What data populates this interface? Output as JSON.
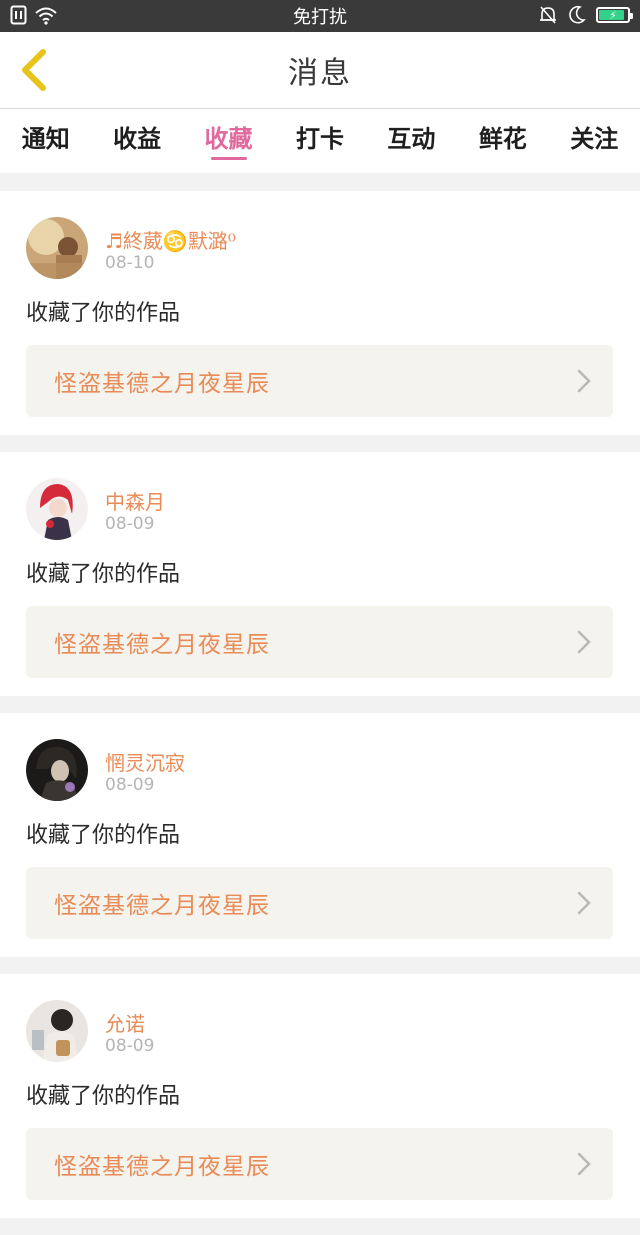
{
  "status_bar": {
    "mode_label": "免打扰",
    "battery_level": 0.9,
    "colors": {
      "background": "#3a3a3a",
      "battery": "#33d18a"
    },
    "icons": [
      "sim-icon",
      "wifi-icon",
      "mute-bell-icon",
      "moon-icon",
      "battery-icon"
    ]
  },
  "header": {
    "title": "消息",
    "back_icon": "chevron-left-icon",
    "colors": {
      "back": "#e8c31a"
    }
  },
  "tabs": [
    {
      "label": "通知",
      "active": false
    },
    {
      "label": "收益",
      "active": false
    },
    {
      "label": "收藏",
      "active": true
    },
    {
      "label": "打卡",
      "active": false
    },
    {
      "label": "互动",
      "active": false
    },
    {
      "label": "鲜花",
      "active": false
    },
    {
      "label": "关注",
      "active": false
    }
  ],
  "colors": {
    "accent": "#e06a9d",
    "username": "#e98b57",
    "work_bg": "#f4f3ee"
  },
  "messages": [
    {
      "username": "♬終葳♋默潞⁰",
      "date": "08-10",
      "action": "收藏了你的作品",
      "work_title": "怪盗基德之月夜星辰"
    },
    {
      "username": "中森月",
      "date": "08-09",
      "action": "收藏了你的作品",
      "work_title": "怪盗基德之月夜星辰"
    },
    {
      "username": "惘灵沉寂",
      "date": "08-09",
      "action": "收藏了你的作品",
      "work_title": "怪盗基德之月夜星辰"
    },
    {
      "username": "允诺",
      "date": "08-09",
      "action": "收藏了你的作品",
      "work_title": "怪盗基德之月夜星辰"
    }
  ]
}
